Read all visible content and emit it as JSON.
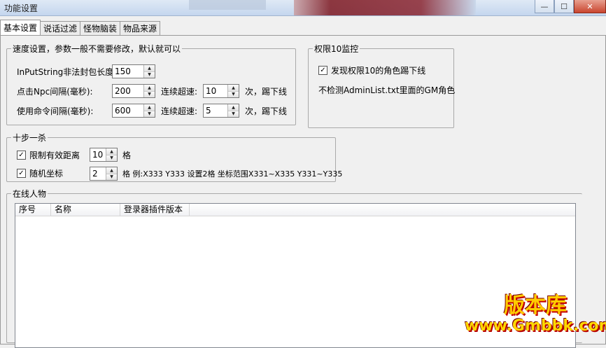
{
  "window": {
    "title": "功能设置",
    "controls": [
      "minimize-icon",
      "maximize-icon",
      "close-icon"
    ]
  },
  "tabs": [
    {
      "label": "基本设置",
      "active": true
    },
    {
      "label": "说话过滤",
      "active": false
    },
    {
      "label": "怪物脑装",
      "active": false
    },
    {
      "label": "物品来源",
      "active": false
    }
  ],
  "speed": {
    "legend": "速度设置，参数一般不需要修改，默认就可以",
    "inputstring_label": "InPutString非法封包长度:",
    "inputstring_value": "150",
    "npc_label": "点击Npc间隔(毫秒):",
    "npc_value": "200",
    "npc_exceed_label": "连续超速:",
    "npc_exceed_value": "10",
    "npc_suffix": "次，踢下线",
    "cmd_label": "使用命令间隔(毫秒):",
    "cmd_value": "600",
    "cmd_exceed_label": "连续超速:",
    "cmd_exceed_value": "5",
    "cmd_suffix": "次，踢下线"
  },
  "perm": {
    "legend": "权限10监控",
    "kick_label": "发现权限10的角色踢下线",
    "kick_checked": true,
    "note": "不检测AdminList.txt里面的GM角色"
  },
  "tenstep": {
    "legend": "十步一杀",
    "limit_label": "限制有效距离",
    "limit_checked": true,
    "limit_value": "10",
    "limit_unit": "格",
    "random_label": "随机坐标",
    "random_checked": true,
    "random_value": "2",
    "random_note": "格 例:X333 Y333 设置2格 坐标范围X331~X335 Y331~Y335"
  },
  "online": {
    "legend": "在线人物",
    "columns": [
      "序号",
      "名称",
      "登录器插件版本"
    ]
  },
  "watermark": {
    "brand": "版本库",
    "url": "www.Gmbbk.com"
  }
}
